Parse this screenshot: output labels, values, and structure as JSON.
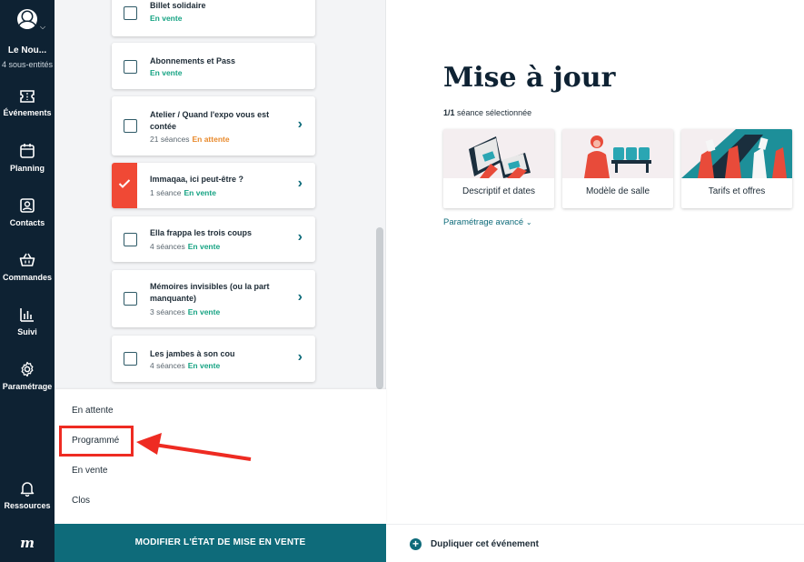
{
  "sidebar": {
    "account_name": "Le Nou...",
    "account_sub": "4 sous-entités",
    "nav": [
      {
        "label": "Événements",
        "icon": "ticket-icon"
      },
      {
        "label": "Planning",
        "icon": "calendar-icon"
      },
      {
        "label": "Contacts",
        "icon": "contact-card-icon"
      },
      {
        "label": "Commandes",
        "icon": "basket-icon"
      },
      {
        "label": "Suivi",
        "icon": "bar-chart-icon"
      },
      {
        "label": "Paramétrage",
        "icon": "gear-icon"
      }
    ],
    "resources_label": "Ressources",
    "logo_text": "m"
  },
  "events": [
    {
      "title": "Billet solidaire",
      "count": "",
      "status": "En vente",
      "status_color": "#16a383",
      "selected": false,
      "has_arrow": false
    },
    {
      "title": "Abonnements et Pass",
      "count": "",
      "status": "En vente",
      "status_color": "#16a383",
      "selected": false,
      "has_arrow": false
    },
    {
      "title": "Atelier / Quand l'expo vous est contée",
      "count": "21 séances",
      "status": "En attente",
      "status_color": "#e8892b",
      "selected": false,
      "has_arrow": true
    },
    {
      "title": "Immaqaa, ici peut-être ?",
      "count": "1 séance",
      "status": "En vente",
      "status_color": "#16a383",
      "selected": true,
      "has_arrow": true
    },
    {
      "title": "Ella frappa les trois coups",
      "count": "4 séances",
      "status": "En vente",
      "status_color": "#16a383",
      "selected": false,
      "has_arrow": true
    },
    {
      "title": "Mémoires invisibles (ou la part manquante)",
      "count": "3 séances",
      "status": "En vente",
      "status_color": "#16a383",
      "selected": false,
      "has_arrow": true
    },
    {
      "title": "Les jambes à son cou",
      "count": "4 séances",
      "status": "En vente",
      "status_color": "#16a383",
      "selected": false,
      "has_arrow": true
    }
  ],
  "dropdown": {
    "options": [
      "En attente",
      "Programmé",
      "En vente",
      "Clos"
    ],
    "highlighted": "Programmé"
  },
  "bottom": {
    "modify_button": "MODIFIER L'ÉTAT DE MISE EN VENTE",
    "duplicate_label": "Dupliquer cet événement"
  },
  "main": {
    "title": "Mise à jour",
    "selection_count": "1/1",
    "selection_text": "séance sélectionnée",
    "tiles": [
      {
        "label": "Descriptif et dates"
      },
      {
        "label": "Modèle de salle"
      },
      {
        "label": "Tarifs et offres"
      }
    ],
    "advanced_label": "Paramétrage avancé"
  },
  "colors": {
    "sidebar_bg": "#0e2233",
    "accent_teal": "#0e6b7a",
    "selected_red": "#f04935",
    "status_green": "#16a383",
    "status_orange": "#e8892b",
    "annotation_red": "#ee2b22"
  }
}
